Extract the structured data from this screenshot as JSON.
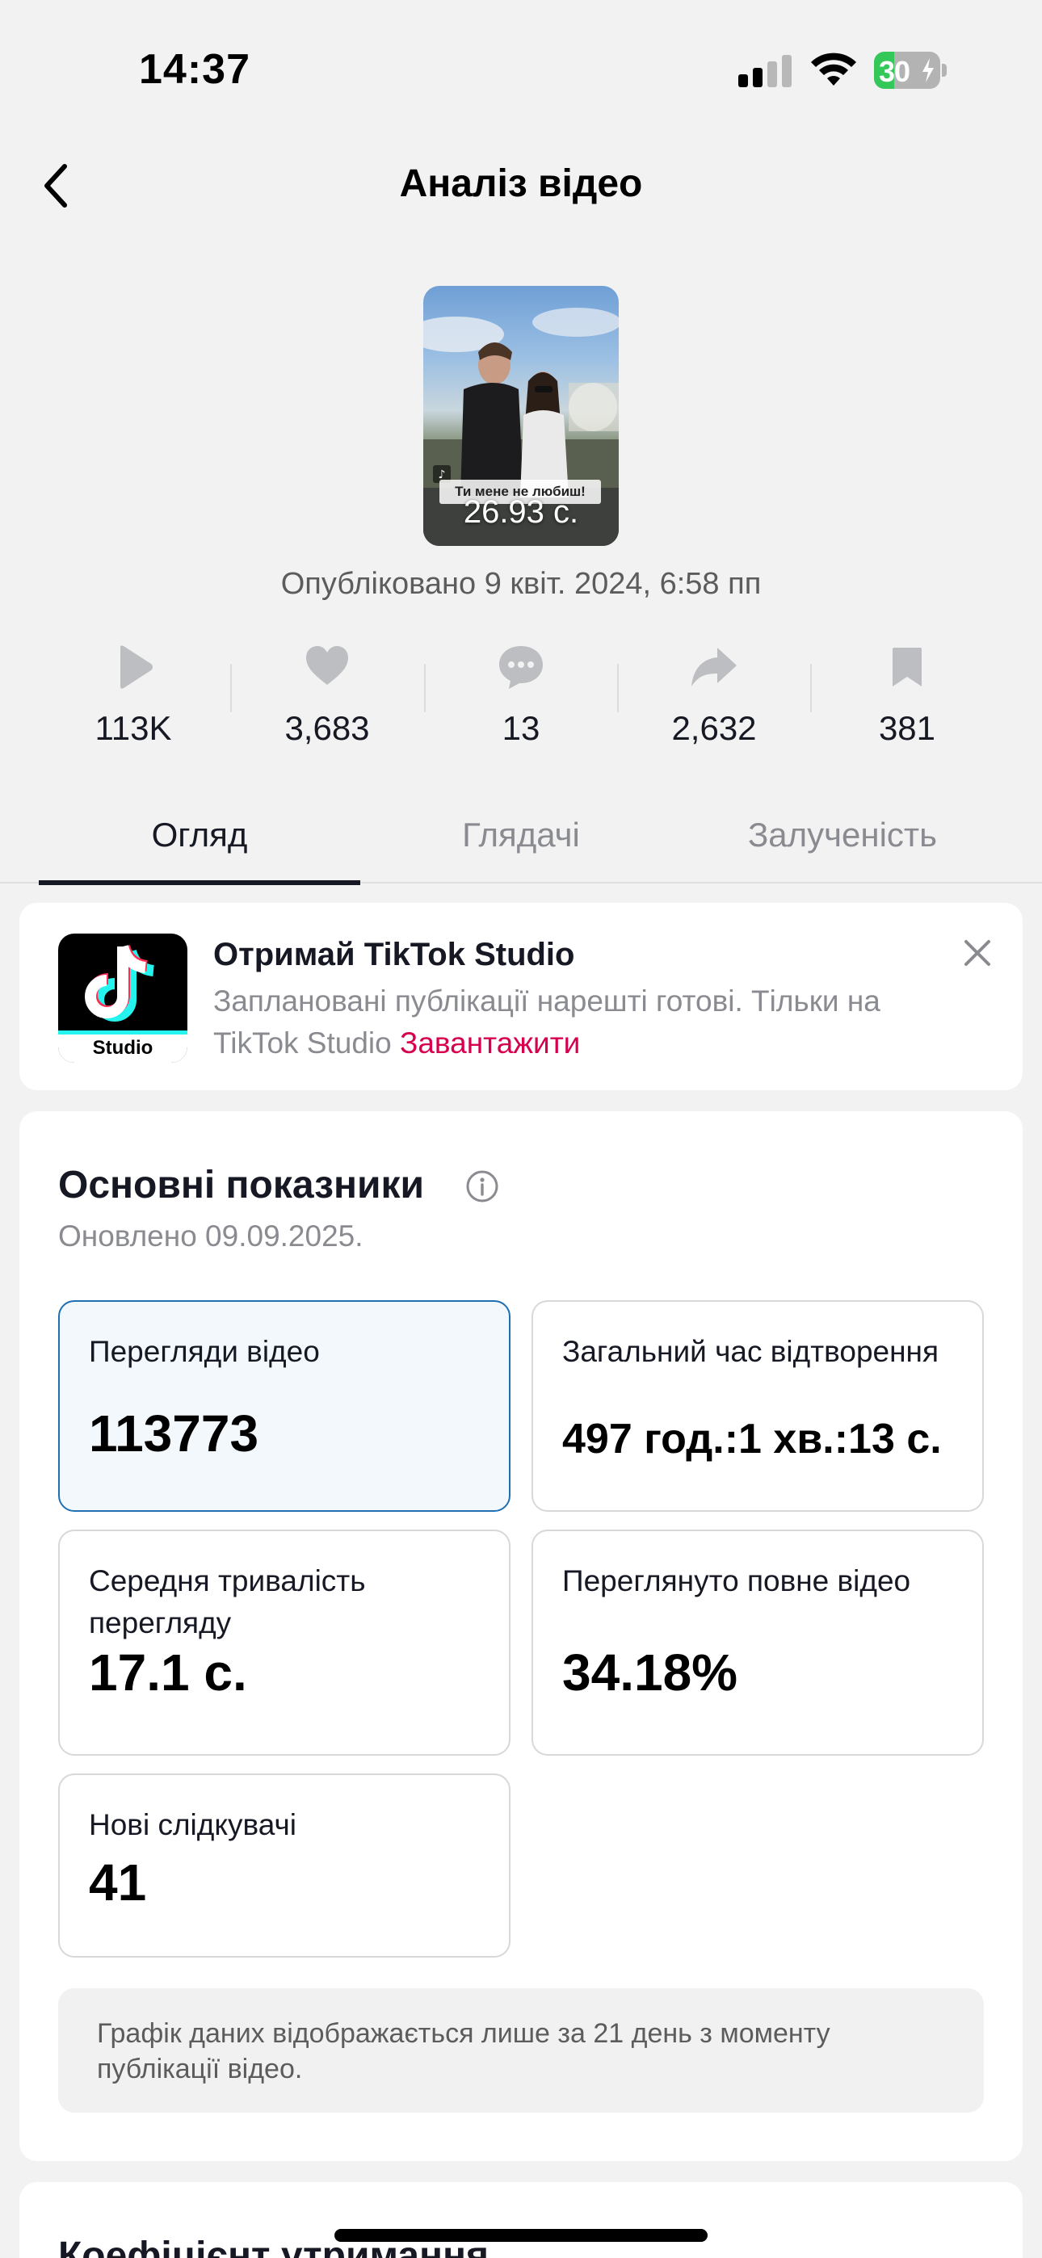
{
  "status_bar": {
    "time": "14:37",
    "battery": "30",
    "battery_level": 0.3
  },
  "header": {
    "title": "Аналіз відео",
    "back_icon": "chevron-left-icon"
  },
  "video": {
    "duration": "26.93 с.",
    "caption_overlay": "Ти мене не любиш!",
    "published": "Опубліковано 9 квіт. 2024, 6:58 пп"
  },
  "stats": [
    {
      "icon": "play-icon",
      "value": "113K"
    },
    {
      "icon": "heart-icon",
      "value": "3,683"
    },
    {
      "icon": "comment-icon",
      "value": "13"
    },
    {
      "icon": "share-icon",
      "value": "2,632"
    },
    {
      "icon": "bookmark-icon",
      "value": "381"
    }
  ],
  "tabs": [
    {
      "label": "Огляд",
      "active": true
    },
    {
      "label": "Глядачі",
      "active": false
    },
    {
      "label": "Залученість",
      "active": false
    }
  ],
  "promo": {
    "logo_label": "Studio",
    "title": "Отримай TikTok Studio",
    "text": "Заплановані публікації нарешті готові. Тільки на TikTok Studio ",
    "link": "Завантажити"
  },
  "metrics": {
    "title": "Основні показники",
    "updated": "Оновлено 09.09.2025.",
    "tiles": [
      {
        "label": "Перегляди відео",
        "value": "113773"
      },
      {
        "label": "Загальний час відтворення",
        "value": "497 год.:1 хв.:13 с."
      },
      {
        "label": "Середня тривалість перегляду",
        "value": "17.1 с."
      },
      {
        "label": "Переглянуто повне відео",
        "value": "34.18%"
      },
      {
        "label": "Нові слідкувачі",
        "value": "41"
      }
    ],
    "note": "Графік даних відображається лише за 21 день з моменту публікації відео."
  },
  "next_section": {
    "title": "Коефіцієнт утримання"
  },
  "colors": {
    "accent_link": "#d6004e",
    "selected_border": "#1f6fb2",
    "battery_green": "#34c759"
  }
}
